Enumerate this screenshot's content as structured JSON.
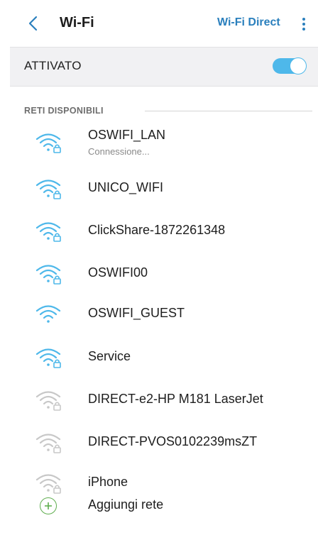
{
  "header": {
    "title": "Wi-Fi",
    "wifi_direct_label": "Wi-Fi Direct"
  },
  "toggle": {
    "label": "ATTIVATO",
    "state": "on"
  },
  "section": {
    "title": "RETI DISPONIBILI"
  },
  "networks": [
    {
      "name": "OSWIFI_LAN",
      "status": "Connessione...",
      "secured": true,
      "signal": "strong"
    },
    {
      "name": "UNICO_WIFI",
      "status": "",
      "secured": true,
      "signal": "strong"
    },
    {
      "name": "ClickShare-1872261348",
      "status": "",
      "secured": true,
      "signal": "strong"
    },
    {
      "name": "OSWIFI00",
      "status": "",
      "secured": true,
      "signal": "strong"
    },
    {
      "name": "OSWIFI_GUEST",
      "status": "",
      "secured": false,
      "signal": "strong"
    },
    {
      "name": "Service",
      "status": "",
      "secured": true,
      "signal": "strong"
    },
    {
      "name": "DIRECT-e2-HP M181 LaserJet",
      "status": "",
      "secured": true,
      "signal": "weak"
    },
    {
      "name": "DIRECT-PVOS0102239msZT",
      "status": "",
      "secured": true,
      "signal": "weak"
    },
    {
      "name": "iPhone",
      "status": "",
      "secured": true,
      "signal": "weak"
    }
  ],
  "add_network": {
    "label": "Aggiungi rete"
  },
  "colors": {
    "accent": "#2a7fbd",
    "wifi_strong": "#4eb8ea",
    "wifi_weak": "#c8c8c8",
    "add_icon": "#5fae4f"
  }
}
